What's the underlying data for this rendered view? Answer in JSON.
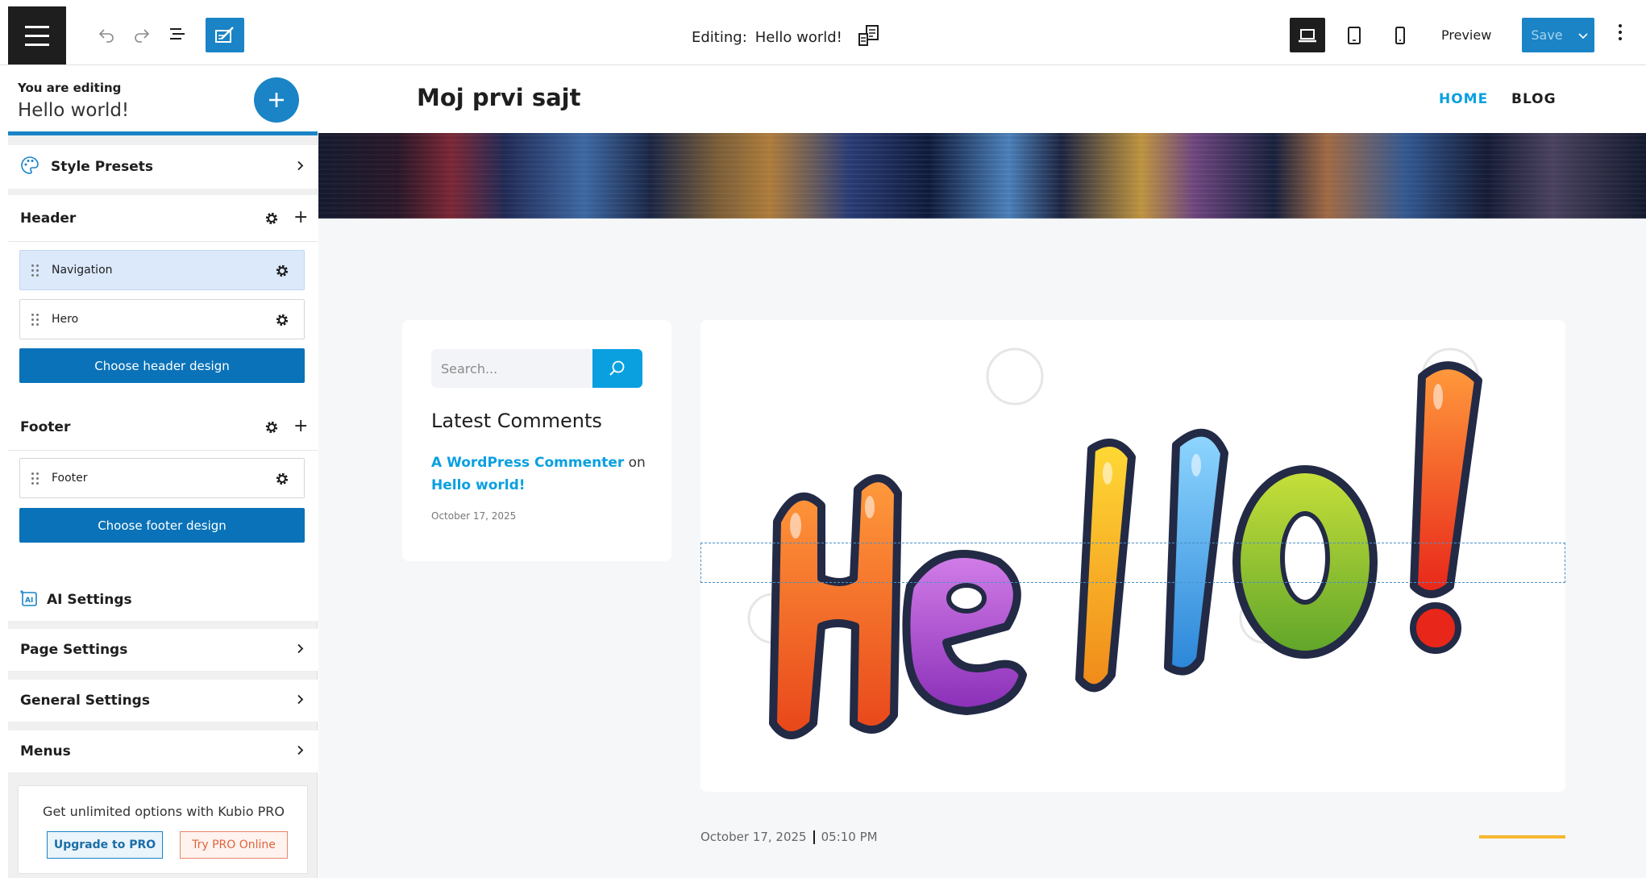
{
  "toolbar": {
    "editing_label": "Editing:",
    "editing_title": "Hello world!",
    "preview_label": "Preview",
    "save_label": "Save"
  },
  "sidebar": {
    "editing_label": "You are editing",
    "editing_title": "Hello world!",
    "style_presets": "Style Presets",
    "header": {
      "title": "Header",
      "items": [
        "Navigation",
        "Hero"
      ],
      "choose_button": "Choose header design"
    },
    "footer": {
      "title": "Footer",
      "items": [
        "Footer"
      ],
      "choose_button": "Choose footer design"
    },
    "ai_settings": "AI Settings",
    "page_settings": "Page Settings",
    "general_settings": "General Settings",
    "menus": "Menus",
    "promo": {
      "text": "Get unlimited options with Kubio PRO",
      "upgrade": "Upgrade to PRO",
      "try": "Try PRO Online"
    }
  },
  "site": {
    "title": "Moj prvi sajt",
    "nav": [
      "HOME",
      "BLOG"
    ],
    "accent": "#0aa0e0"
  },
  "widget": {
    "search_placeholder": "Search...",
    "title": "Latest Comments",
    "commenter": "A WordPress Commenter",
    "on": "on",
    "post_link": "Hello world!",
    "date": "October 17, 2025"
  },
  "post": {
    "image_text": "Hello!",
    "date": "October 17, 2025",
    "time": "05:10 PM"
  },
  "colors": {
    "primary": "#1a84c6",
    "dark": "#1e1e1e",
    "accent_line": "#f5b731"
  }
}
